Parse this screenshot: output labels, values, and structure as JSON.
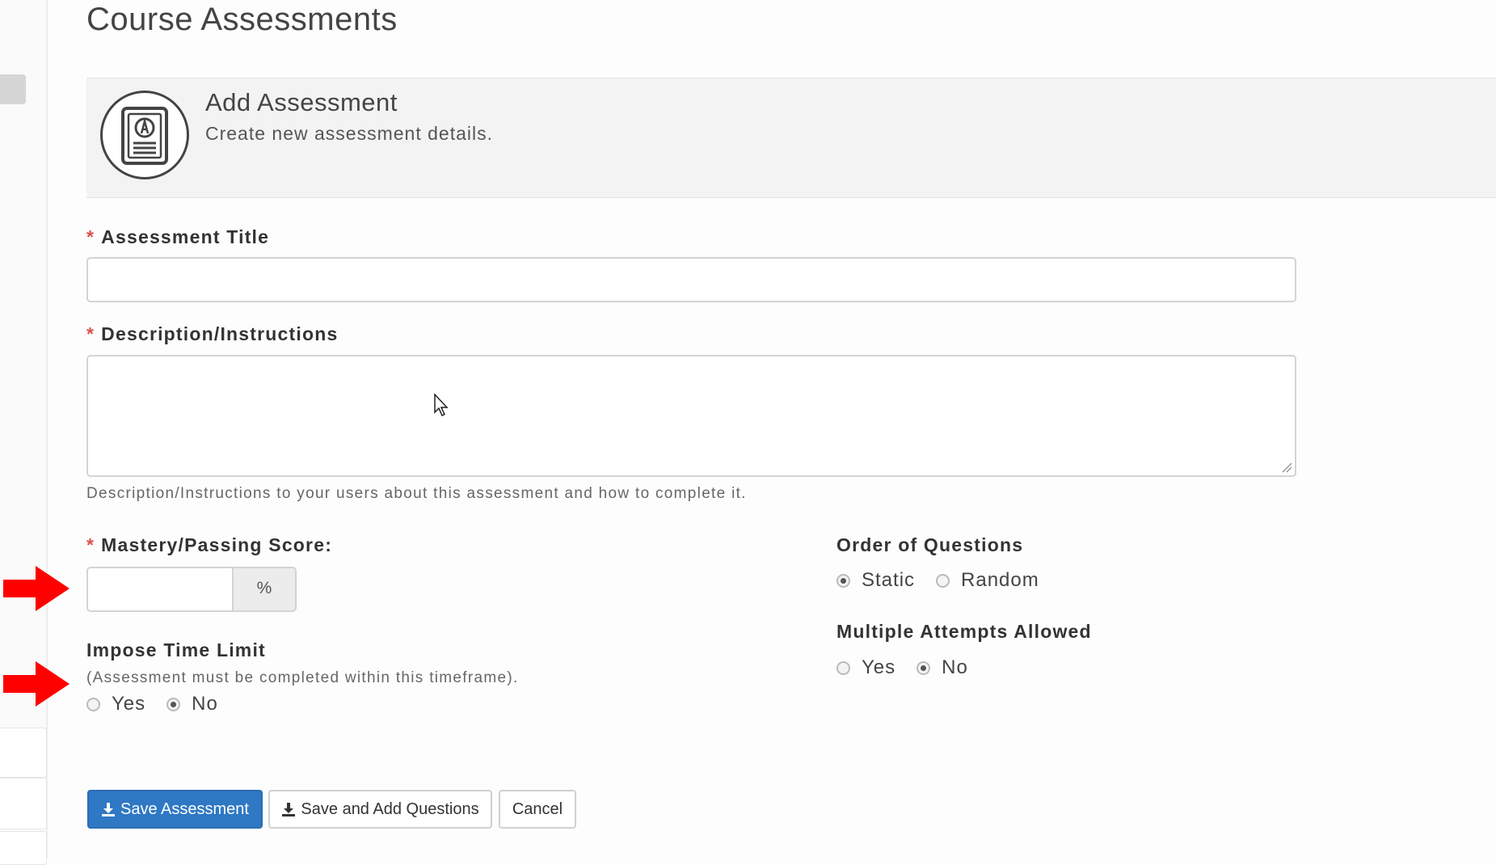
{
  "page": {
    "title": "Course Assessments"
  },
  "panel": {
    "icon": "assessment-document-icon",
    "heading": "Add Assessment",
    "subheading": "Create new assessment details."
  },
  "form": {
    "required_marker": "*",
    "title_field": {
      "label": "Assessment Title",
      "value": "",
      "placeholder": ""
    },
    "description_field": {
      "label": "Description/Instructions",
      "value": "",
      "help": "Description/Instructions to your users about this assessment and how to complete it."
    },
    "mastery_field": {
      "label": "Mastery/Passing Score:",
      "value": "",
      "addon": "%"
    },
    "time_limit": {
      "label": "Impose Time Limit",
      "help": "(Assessment must be completed within this timeframe).",
      "options": [
        "Yes",
        "No"
      ],
      "selected": "No"
    },
    "order_of_questions": {
      "label": "Order of Questions",
      "options": [
        "Static",
        "Random"
      ],
      "selected": "Static"
    },
    "multiple_attempts": {
      "label": "Multiple Attempts Allowed",
      "options": [
        "Yes",
        "No"
      ],
      "selected": "No"
    }
  },
  "buttons": {
    "save": "Save Assessment",
    "save_add": "Save and Add Questions",
    "cancel": "Cancel",
    "save_icon": "download-icon"
  },
  "colors": {
    "primary": "#2f78c4",
    "required": "#d9534f",
    "annotation_arrow": "#ff0000"
  }
}
